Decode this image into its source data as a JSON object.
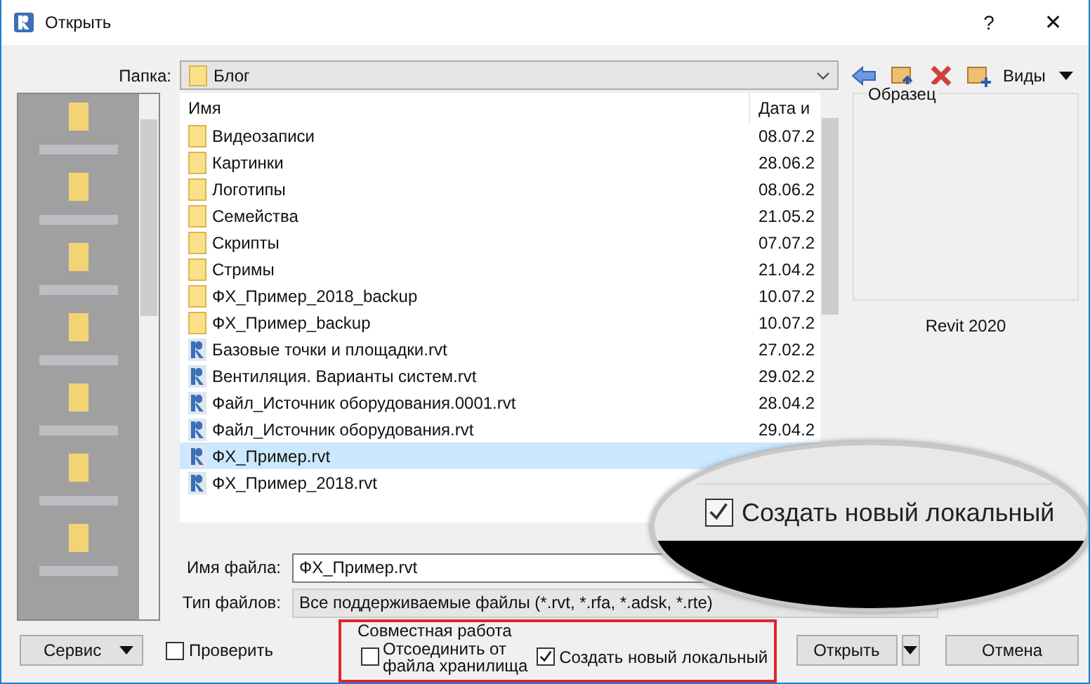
{
  "window": {
    "title": "Открыть",
    "help": "?",
    "close": "✕"
  },
  "folder": {
    "label": "Папка:",
    "value": "Блог",
    "views": "Виды"
  },
  "file_list": {
    "columns": [
      "Имя",
      "Дата и"
    ],
    "rows": [
      {
        "kind": "folder",
        "name": "Видеозаписи",
        "date": "08.07.2",
        "selected": false
      },
      {
        "kind": "folder",
        "name": "Картинки",
        "date": "28.06.2",
        "selected": false
      },
      {
        "kind": "folder",
        "name": "Логотипы",
        "date": "08.06.2",
        "selected": false
      },
      {
        "kind": "folder",
        "name": "Семейства",
        "date": "21.05.2",
        "selected": false
      },
      {
        "kind": "folder",
        "name": "Скрипты",
        "date": "07.07.2",
        "selected": false
      },
      {
        "kind": "folder",
        "name": "Стримы",
        "date": "21.04.2",
        "selected": false
      },
      {
        "kind": "folder",
        "name": "ФХ_Пример_2018_backup",
        "date": "10.07.2",
        "selected": false
      },
      {
        "kind": "folder",
        "name": "ФХ_Пример_backup",
        "date": "10.07.2",
        "selected": false
      },
      {
        "kind": "file",
        "name": "Базовые точки и площадки.rvt",
        "date": "27.02.2",
        "selected": false
      },
      {
        "kind": "file",
        "name": "Вентиляция. Варианты систем.rvt",
        "date": "29.02.2",
        "selected": false
      },
      {
        "kind": "file",
        "name": "Файл_Источник оборудования.0001.rvt",
        "date": "28.04.2",
        "selected": false
      },
      {
        "kind": "file",
        "name": "Файл_Источник оборудования.rvt",
        "date": "29.04.2",
        "selected": false
      },
      {
        "kind": "file",
        "name": "ФХ_Пример.rvt",
        "selected": true
      },
      {
        "kind": "file",
        "name": "ФХ_Пример_2018.rvt",
        "selected": false
      }
    ]
  },
  "preview": {
    "title": "Образец",
    "version": "Revit 2020"
  },
  "file_name": {
    "label": "Имя файла:",
    "value": "ФХ_Пример.rvt"
  },
  "file_type": {
    "label": "Тип файлов:",
    "value": "Все поддерживаемые файлы  (*.rvt, *.rfa, *.adsk, *.rte)"
  },
  "buttons": {
    "tools": "Сервис",
    "open": "Открыть",
    "cancel": "Отмена"
  },
  "audit": {
    "label": "Проверить",
    "checked": false
  },
  "worksharing": {
    "title": "Совместная работа",
    "detach": {
      "label": "Отсоединить от файла хранилища",
      "checked": false
    },
    "create_local": {
      "label": "Создать новый локальный",
      "checked": true
    }
  },
  "magnifier": {
    "label": "Создать новый локальный",
    "checked": true
  }
}
